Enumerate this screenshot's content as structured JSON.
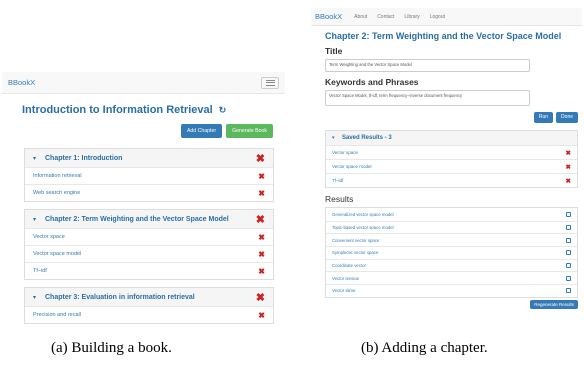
{
  "panel_a": {
    "navbar": {
      "brand": "BBookX"
    },
    "book_title": "Introduction to Information Retrieval",
    "refresh_glyph": "↻",
    "buttons": {
      "add_chapter": "Add Chapter",
      "generate_book": "Generate Book"
    },
    "chapters": [
      {
        "title": "Chapter 1: Introduction",
        "items": [
          "Information retrieval",
          "Web search engine"
        ]
      },
      {
        "title": "Chapter 2: Term Weighting and the Vector Space Model",
        "items": [
          "Vector space",
          "Vector space model",
          "Tf–idf"
        ]
      },
      {
        "title": "Chapter 3: Evaluation in information retrieval",
        "items": [
          "Precision and recall"
        ]
      }
    ]
  },
  "panel_b": {
    "navbar": {
      "brand": "BBookX",
      "links": [
        "About",
        "Contact",
        "Library",
        "Logout"
      ]
    },
    "chapter_title": "Chapter 2: Term Weighting and the Vector Space Model",
    "title_label": "Title",
    "title_value": "Term Weighting and the Vector Space Model",
    "keywords_label": "Keywords and Phrases",
    "keywords_value": "Vector Space Model, tf-idf, term frequency–inverse document frequency",
    "buttons": {
      "run": "Run",
      "done": "Done",
      "regenerate": "Regenerate Results"
    },
    "saved_title": "Saved Results - 3",
    "saved": [
      "Vector space",
      "Vector space model",
      "Tf–idf"
    ],
    "results_label": "Results",
    "results": [
      "Generalized vector space model",
      "Topic-based vector space model",
      "Convenient vector space",
      "Symplectic vector space",
      "Coordinate vector",
      "Vector tension",
      "Vector slime"
    ]
  },
  "captions": {
    "a": "(a) Building a book.",
    "b": "(b) Adding a chapter."
  },
  "colors": {
    "link": "#337ab7",
    "heading": "#2a6ea6",
    "delete": "#cc2222",
    "primary": "#337ab7",
    "success": "#5cb85c"
  },
  "icons": {
    "chevron": "chevron-down-icon",
    "delete": "close-icon",
    "refresh": "refresh-icon",
    "menu": "hamburger-icon"
  }
}
